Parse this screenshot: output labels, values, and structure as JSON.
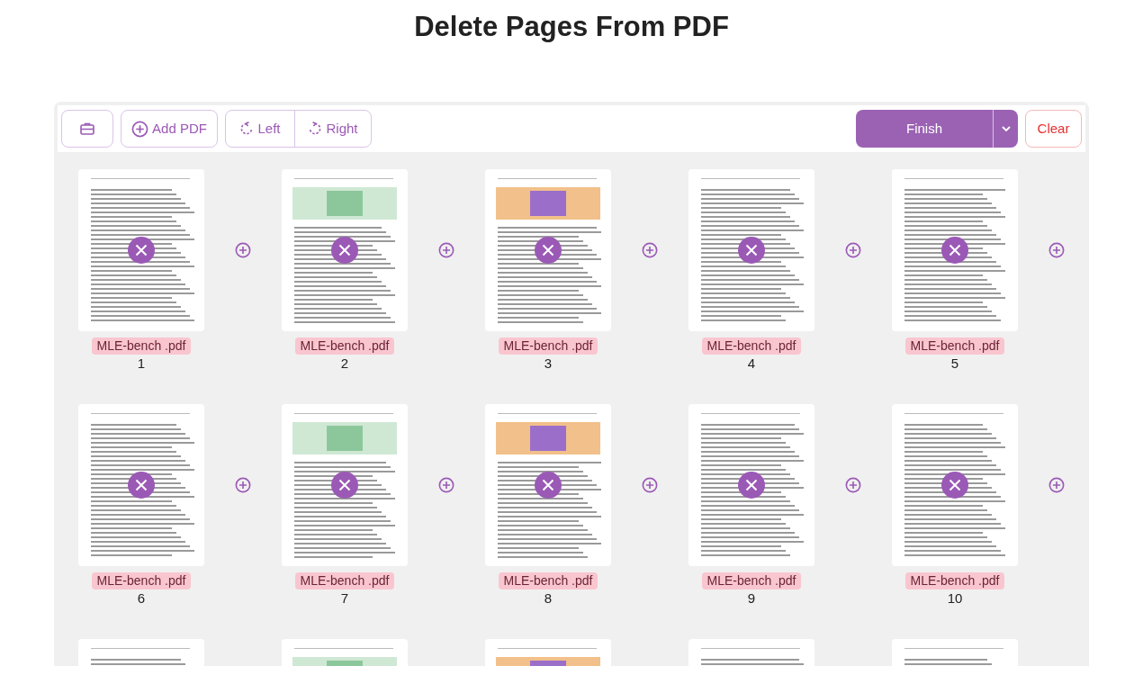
{
  "title": "Delete Pages From PDF",
  "toolbar": {
    "left": [
      {
        "kind": "tools"
      },
      {
        "kind": "add",
        "label": "Add PDF"
      }
    ],
    "rotate": [
      {
        "kind": "left",
        "label": "Left"
      },
      {
        "kind": "right",
        "label": "Right"
      }
    ],
    "finish": "Finish",
    "clear": "Clear"
  },
  "pages": [
    {
      "kind": "full",
      "file": "MLE-bench .pdf",
      "number": "1"
    },
    {
      "kind": "full",
      "file": "MLE-bench .pdf",
      "number": "2"
    },
    {
      "kind": "full",
      "file": "MLE-bench .pdf",
      "number": "3"
    },
    {
      "kind": "full",
      "file": "MLE-bench .pdf",
      "number": "4"
    },
    {
      "kind": "full",
      "file": "MLE-bench .pdf",
      "number": "5"
    },
    {
      "kind": "full",
      "file": "MLE-bench .pdf",
      "number": "6"
    },
    {
      "kind": "full",
      "file": "MLE-bench .pdf",
      "number": "7"
    },
    {
      "kind": "full",
      "file": "MLE-bench .pdf",
      "number": "8"
    },
    {
      "kind": "full",
      "file": "MLE-bench .pdf",
      "number": "9"
    },
    {
      "kind": "full",
      "file": "MLE-bench .pdf",
      "number": "10"
    },
    {
      "kind": "cut"
    },
    {
      "kind": "cut"
    },
    {
      "kind": "cut"
    },
    {
      "kind": "cut"
    },
    {
      "kind": "cut"
    }
  ]
}
